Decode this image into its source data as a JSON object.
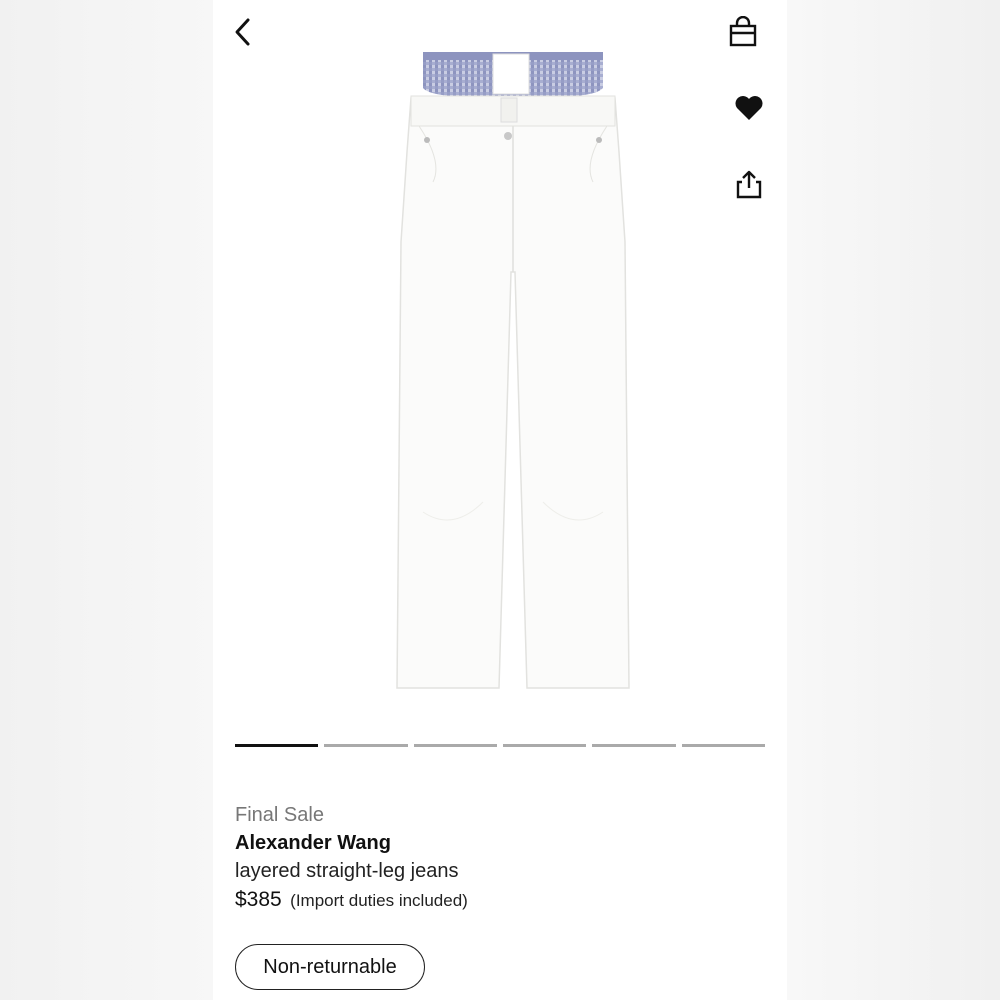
{
  "nav": {
    "back_icon": "chevron-left-icon",
    "bag_icon": "shopping-bag-icon",
    "wishlist_icon": "heart-icon",
    "share_icon": "share-icon"
  },
  "product": {
    "image": "white-layered-jeans",
    "sale_label": "Final Sale",
    "brand": "Alexander Wang",
    "name": "layered straight-leg jeans",
    "price": "$385",
    "duties_note": "(Import duties included)",
    "return_badge": "Non-returnable"
  },
  "carousel": {
    "total": 6,
    "active_index": 0
  },
  "colors": {
    "active_indicator": "#111111",
    "inactive_indicator": "#aaaaaa",
    "sale_text": "#777777"
  }
}
